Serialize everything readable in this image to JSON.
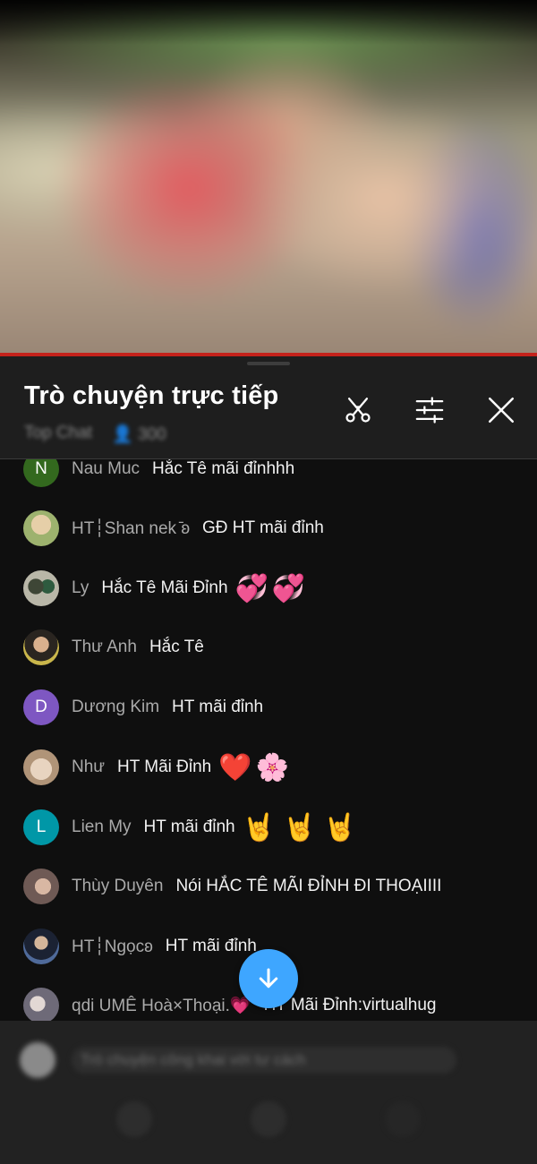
{
  "header": {
    "title": "Trò chuyện trực tiếp",
    "subtitle_blurred": "Top Chat",
    "viewer_count_blurred": "300"
  },
  "icons": {
    "clip": "scissors-icon",
    "settings": "sliders-icon",
    "close": "close-icon",
    "scroll_down": "arrow-down-icon"
  },
  "colors": {
    "accent": "#3ea6ff",
    "progress": "#c4221b"
  },
  "messages": [
    {
      "author": "Nau Muc",
      "text": "Hắc Tê mãi đỉnhhh",
      "avatar": {
        "type": "letter",
        "letter": "N",
        "color": "#33691e"
      }
    },
    {
      "author": "HT┆Shan nek ̄ʚ",
      "text": "GĐ HT mãi đỉnh",
      "avatar": {
        "type": "photo",
        "color": "#c9a77b"
      }
    },
    {
      "author": "Ly",
      "text": "Hắc Tê Mãi Đỉnh",
      "emojis": [
        "💞",
        "💞"
      ],
      "avatar": {
        "type": "photo",
        "color": "#6b6f58"
      }
    },
    {
      "author": "Thư Anh",
      "text": "Hắc Tê",
      "avatar": {
        "type": "photo",
        "color": "#4a4339"
      }
    },
    {
      "author": "Dương Kim",
      "text": "HT mãi đỉnh",
      "avatar": {
        "type": "letter",
        "letter": "D",
        "color": "#7e57c2"
      }
    },
    {
      "author": "Như",
      "text": "HT Mãi Đỉnh",
      "emojis": [
        "❤️",
        "🌸"
      ],
      "avatar": {
        "type": "photo",
        "color": "#c8a890"
      }
    },
    {
      "author": "Lien My",
      "text": "HT mãi đỉnh",
      "emojis": [
        "🤘",
        "🤘",
        "🤘"
      ],
      "avatar": {
        "type": "letter",
        "letter": "L",
        "color": "#0097a7"
      }
    },
    {
      "author": "Thùy Duyên",
      "text": "Nói HẮC TÊ MÃI ĐỈNH ĐI THOẠIIII",
      "avatar": {
        "type": "photo",
        "color": "#a98b7e"
      }
    },
    {
      "author": "HT┆Ngọcʚ",
      "text": "HT mãi đỉnh",
      "avatar": {
        "type": "photo",
        "color": "#3a4a66"
      }
    },
    {
      "author": "qdi UMÊ Hoà×Thoại.💗",
      "text": "HT Mãi Đỉnh:virtualhug",
      "avatar": {
        "type": "photo",
        "color": "#8c8c94"
      }
    }
  ],
  "input": {
    "placeholder_blurred": "Trò chuyện công khai với tư cách"
  }
}
